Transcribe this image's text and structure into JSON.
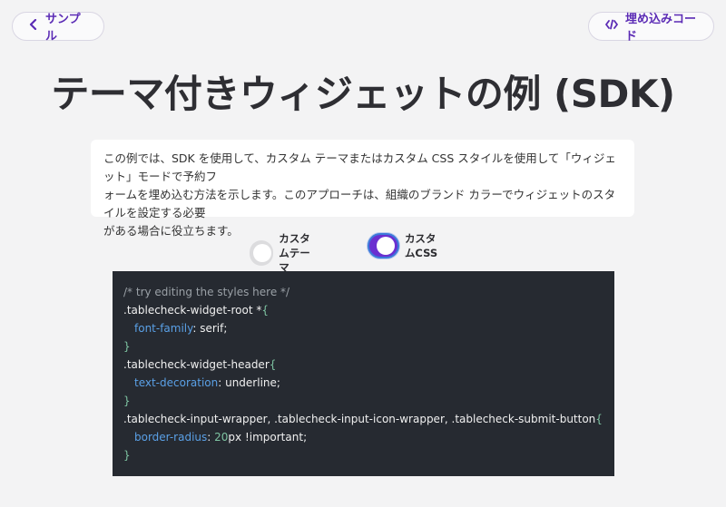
{
  "header": {
    "back_label": "サンプル",
    "embed_label": "埋め込みコード"
  },
  "title": "テーマ付きウィジェットの例 (SDK)",
  "description": {
    "line1": "この例では、SDK を使用して、カスタム テーマまたはカスタム CSS スタイルを使用して「ウィジェット」モードで予約フ",
    "line2": "ォームを埋め込む方法を示します。このアプローチは、組織のブランド カラーでウィジェットのスタイルを設定する必要",
    "line3": "がある場合に役立ちます。"
  },
  "toggles": {
    "theme": {
      "label": "カスタムテーマ",
      "on": false
    },
    "css": {
      "label": "カスタムCSS",
      "on": true
    }
  },
  "code": {
    "comment": "/* try editing the styles here */",
    "rule1": {
      "selector": ".tablecheck-widget-root *",
      "open": "{",
      "prop": "font-family",
      "colon": ": ",
      "value": "serif",
      "semi": ";",
      "close": "}"
    },
    "rule2": {
      "selector": ".tablecheck-widget-header",
      "open": "{",
      "prop": "text-decoration",
      "colon": ": ",
      "value": "underline",
      "semi": ";",
      "close": "}"
    },
    "rule3": {
      "selector": ".tablecheck-input-wrapper, .tablecheck-input-icon-wrapper, .tablecheck-submit-button",
      "open": "{",
      "prop": "border-radius",
      "colon": ": ",
      "num": "20",
      "value": "px !important",
      "semi": ";",
      "close": "}"
    }
  },
  "colors": {
    "accent": "#6a2fd0",
    "editor_bg": "#262a31",
    "page_bg": "#f3f3f4"
  }
}
